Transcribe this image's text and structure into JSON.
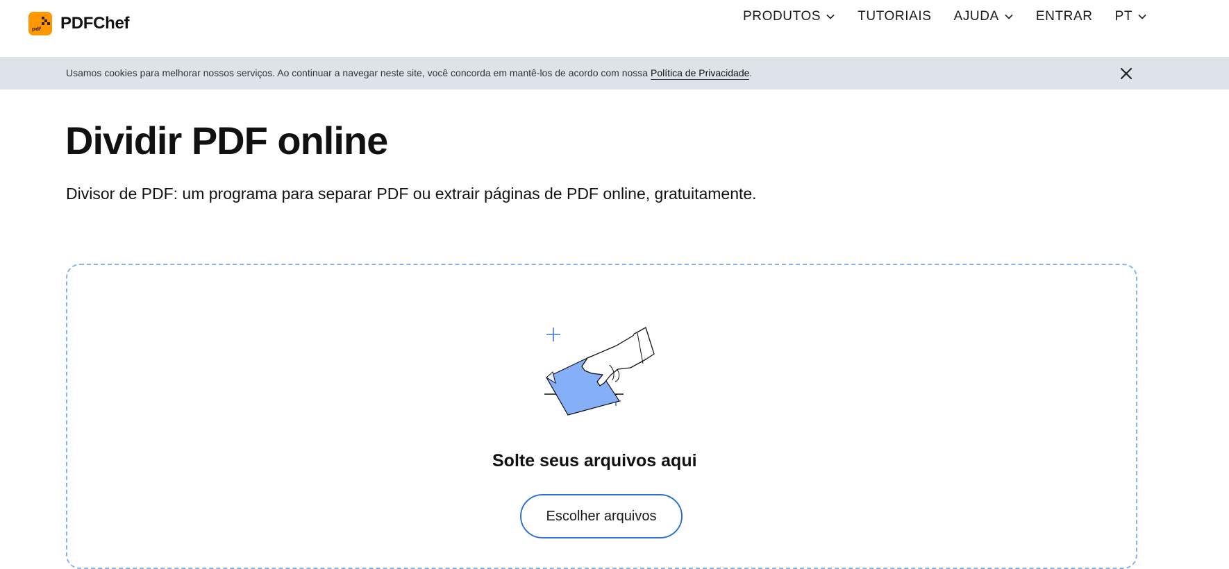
{
  "header": {
    "brand": "PDFChef",
    "logo_text": "pdf",
    "nav": [
      {
        "label": "PRODUTOS",
        "has_dropdown": true
      },
      {
        "label": "TUTORIAIS",
        "has_dropdown": false
      },
      {
        "label": "AJUDA",
        "has_dropdown": true
      },
      {
        "label": "ENTRAR",
        "has_dropdown": false
      },
      {
        "label": "PT",
        "has_dropdown": true
      }
    ]
  },
  "cookie_bar": {
    "text": "Usamos cookies para melhorar nossos serviços. Ao continuar a navegar neste site, você concorda em mantê-los de acordo com nossa ",
    "link_label": "Política de Privacidade",
    "trailing": ".",
    "close_icon": "close-icon"
  },
  "main": {
    "title": "Dividir PDF online",
    "subtitle": "Divisor de PDF: um programa para separar PDF ou extrair páginas de PDF online, gratuitamente."
  },
  "dropzone": {
    "label": "Solte seus arquivos aqui",
    "button_label": "Escolher arquivos",
    "illustration_icon": "hand-dropping-file-icon"
  },
  "colors": {
    "accent": "#2f6fdc",
    "brand_orange": "#ff9800",
    "cookie_bg": "#dde3e8",
    "dropzone_border": "#8ab2ea",
    "file_blue": "#85b0f7"
  }
}
